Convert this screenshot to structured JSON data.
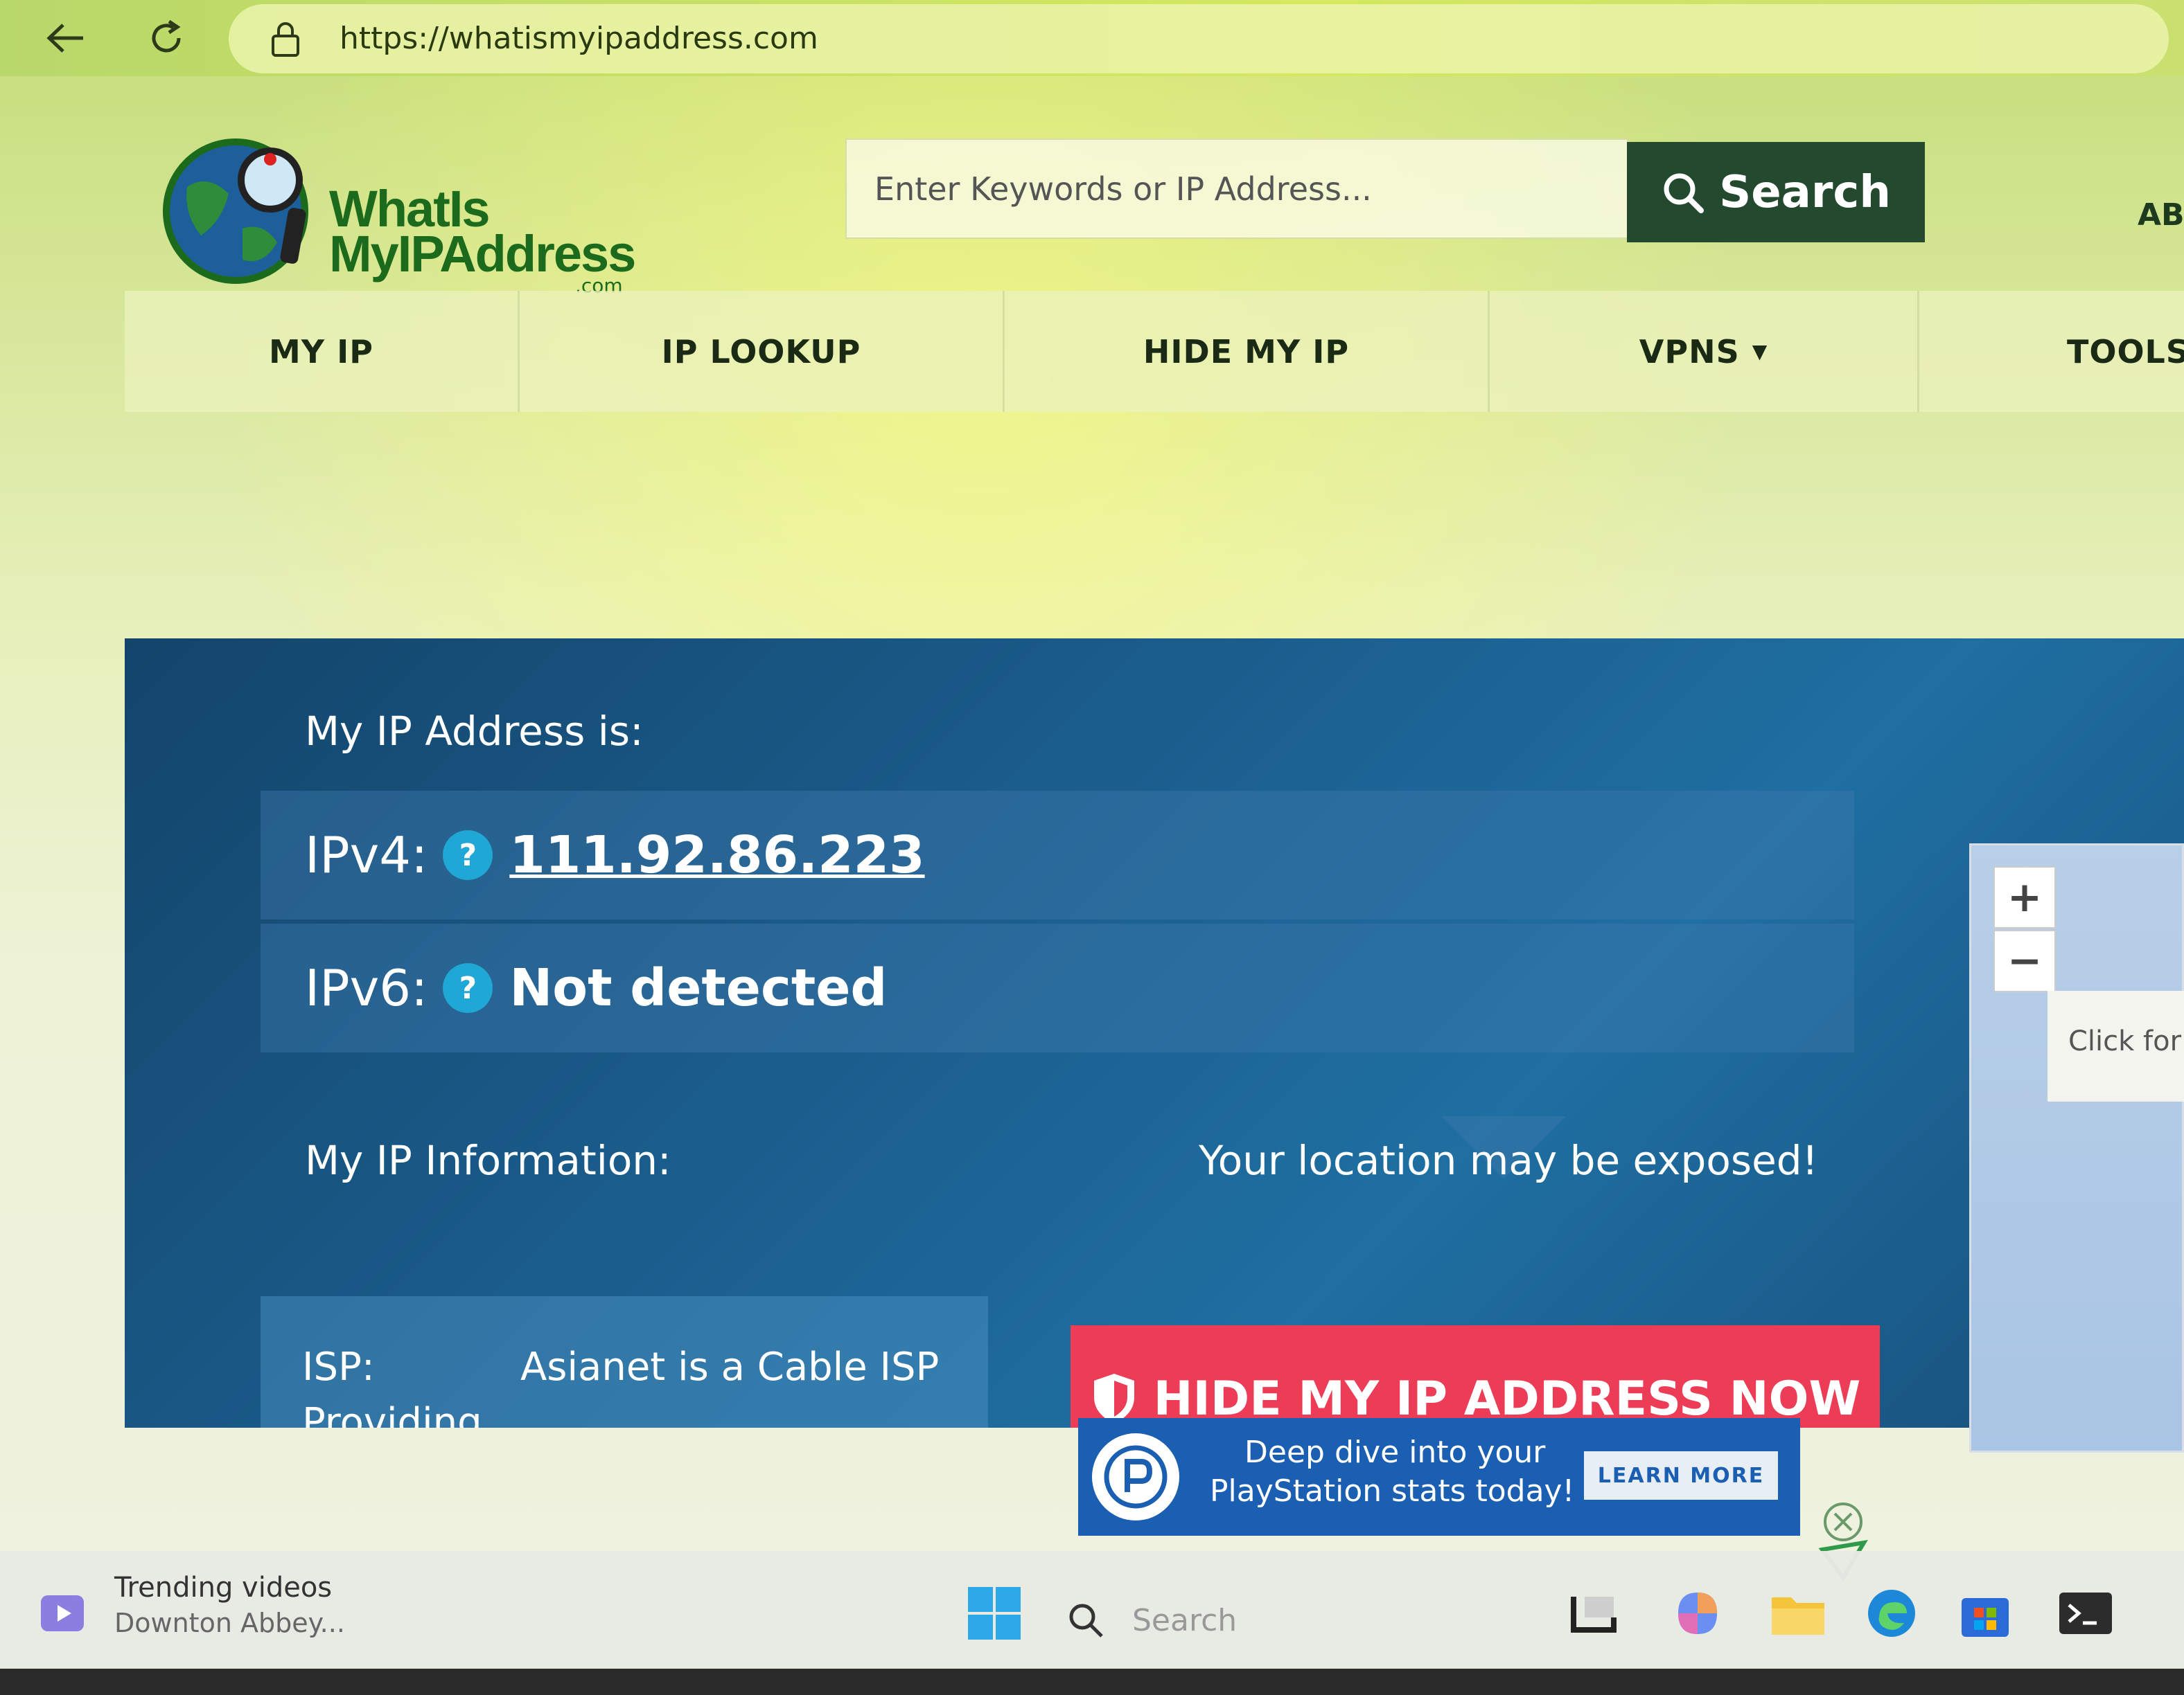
{
  "browser": {
    "url": "https://whatismyipaddress.com"
  },
  "header": {
    "logo_line1": "WhatIs",
    "logo_line2": "MyIPAddress",
    "logo_domain": ".com",
    "search_placeholder": "Enter Keywords or IP Address...",
    "search_button": "Search",
    "about_cut": "AB"
  },
  "nav": {
    "items": [
      "MY IP",
      "IP LOOKUP",
      "HIDE MY IP",
      "VPNS",
      "TOOLS"
    ]
  },
  "ip": {
    "heading": "My IP Address is:",
    "ipv4_label": "IPv4:",
    "ipv4_value": "111.92.86.223",
    "ipv6_label": "IPv6:",
    "ipv6_value": "Not detected",
    "help_glyph": "?",
    "info_heading": "My IP Information:",
    "isp_label": "ISP:",
    "isp_value": "Asianet is a Cable ISP",
    "isp_value_cont": "Providing",
    "exposed_text": "Your location may be exposed!",
    "hide_button": "HIDE MY IP ADDRESS NOW"
  },
  "map": {
    "zoom_in": "+",
    "zoom_out": "−",
    "tooltip": "Click for r"
  },
  "ad": {
    "line1": "Deep dive into your",
    "line2": "PlayStation stats today!",
    "cta": "LEARN MORE"
  },
  "taskbar": {
    "widget_title": "Trending videos",
    "widget_sub": "Downton Abbey...",
    "search_placeholder": "Search"
  },
  "colors": {
    "panel_blue": "#1b5e8e",
    "hide_red": "#ec3c56",
    "search_green": "#234a2e",
    "logo_green": "#1c6b1c"
  }
}
